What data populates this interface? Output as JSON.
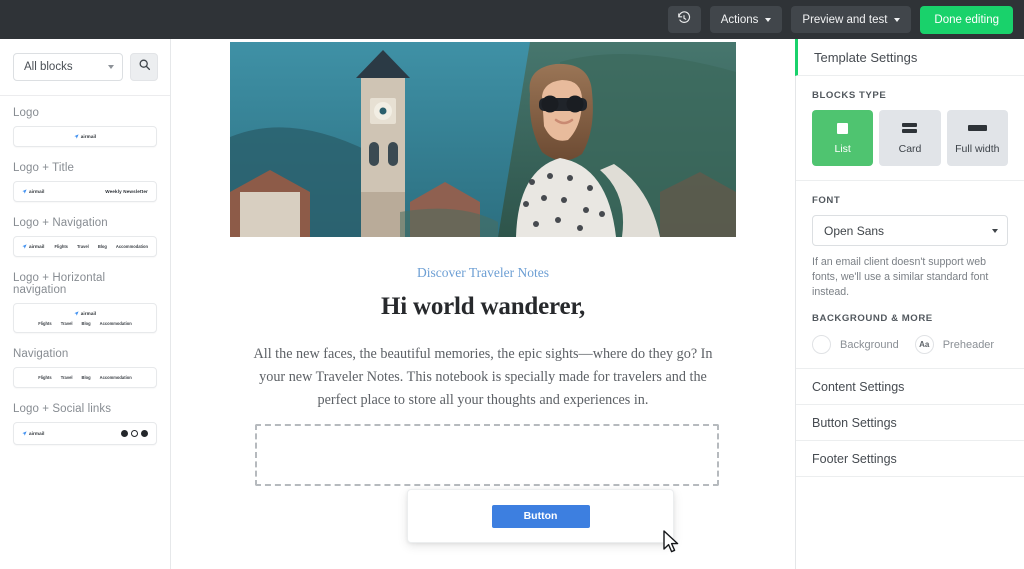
{
  "topbar": {
    "history_icon": "history-revert-icon",
    "actions_label": "Actions",
    "preview_label": "Preview and test",
    "done_label": "Done editing",
    "primary_color": "#19d26b",
    "background_color": "#2f3337"
  },
  "sidebar": {
    "filter_value": "All blocks",
    "search_icon": "search-icon",
    "logo_text": "airmail",
    "groups": [
      {
        "title": "Logo",
        "type": "logo"
      },
      {
        "title": "Logo + Title",
        "type": "logo_title",
        "title_text": "Weekly Newsletter"
      },
      {
        "title": "Logo + Navigation",
        "type": "logo_nav",
        "nav": [
          "Flights",
          "Travel",
          "Blog",
          "Accommodation"
        ]
      },
      {
        "title": "Logo + Horizontal navigation",
        "type": "logo_hnav",
        "nav": [
          "Flights",
          "Travel",
          "Blog",
          "Accommodation"
        ]
      },
      {
        "title": "Navigation",
        "type": "nav",
        "nav": [
          "Flights",
          "Travel",
          "Blog",
          "Accommodation"
        ]
      },
      {
        "title": "Logo + Social links",
        "type": "logo_social"
      }
    ]
  },
  "email": {
    "kicker": "Discover Traveler Notes",
    "headline": "Hi world wanderer,",
    "paragraph": "All the new faces, the beautiful memories, the epic sights—where do they go? In your new Traveler Notes. This notebook is specially made for travelers and the perfect place to store all your thoughts and experiences in.",
    "hero_alt": "woman-in-sunglasses-mountain-village-photo"
  },
  "drag": {
    "button_label": "Button",
    "button_color": "#3d7fe0",
    "cursor_icon": "mouse-pointer-icon"
  },
  "panel": {
    "header": "Template Settings",
    "blocks_type_label": "BLOCKS TYPE",
    "block_types": [
      {
        "label": "List",
        "icon": "list-block-icon",
        "active": true
      },
      {
        "label": "Card",
        "icon": "card-block-icon",
        "active": false
      },
      {
        "label": "Full width",
        "icon": "full-width-block-icon",
        "active": false
      }
    ],
    "font_label": "FONT",
    "font_value": "Open Sans",
    "font_note": "If an email client doesn't support web fonts, we'll use a similar standard font instead.",
    "background_more_label": "BACKGROUND & MORE",
    "background_label": "Background",
    "preheader_label": "Preheader",
    "preheader_icon": "Aa",
    "rows": [
      "Content Settings",
      "Button Settings",
      "Footer Settings"
    ]
  }
}
